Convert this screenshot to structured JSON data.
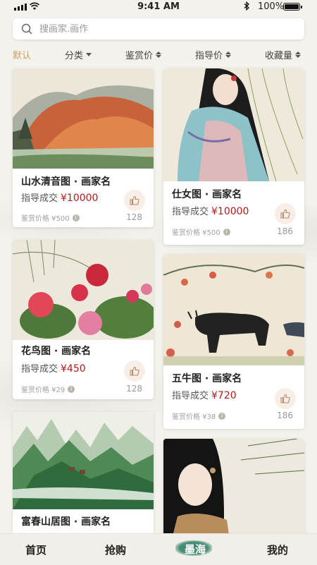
{
  "status": {
    "time": "9:41 AM",
    "battery": "100%"
  },
  "search": {
    "placeholder": "搜画家.画作"
  },
  "filters": [
    {
      "label": "默认",
      "active": true
    },
    {
      "label": "分类"
    },
    {
      "label": "鉴赏价"
    },
    {
      "label": "指导价"
    },
    {
      "label": "收藏量"
    }
  ],
  "cards": [
    {
      "title": "山水清音图 · 画家名",
      "deal_label": "指导成交",
      "price": "¥10000",
      "appraisal": "鉴赏价格 ¥500",
      "likes": "128",
      "image": "landscape-mountains"
    },
    {
      "title": "仕女图 · 画家名",
      "deal_label": "指导成交",
      "price": "¥10000",
      "appraisal": "鉴赏价格 ¥500",
      "likes": "186",
      "image": "lady-painting"
    },
    {
      "title": "花鸟图 · 画家名",
      "deal_label": "指导成交",
      "price": "¥450",
      "appraisal": "鉴赏价格 ¥29",
      "likes": "128",
      "image": "peony-flowers"
    },
    {
      "title": "五牛图 · 画家名",
      "deal_label": "指导成交",
      "price": "¥720",
      "appraisal": "鉴赏价格 ¥38",
      "likes": "186",
      "image": "oxen-painting"
    },
    {
      "title": "富春山居图 · 画家名",
      "image": "green-mountains"
    },
    {
      "image": "lady-portrait"
    }
  ],
  "tabs": [
    {
      "label": "首页"
    },
    {
      "label": "抢购"
    },
    {
      "label": "墨海",
      "active": true
    },
    {
      "label": "我的"
    }
  ],
  "colors": {
    "accent": "#c8a25a",
    "price": "#b51a1a",
    "active_tab": "#3b7f6a"
  }
}
